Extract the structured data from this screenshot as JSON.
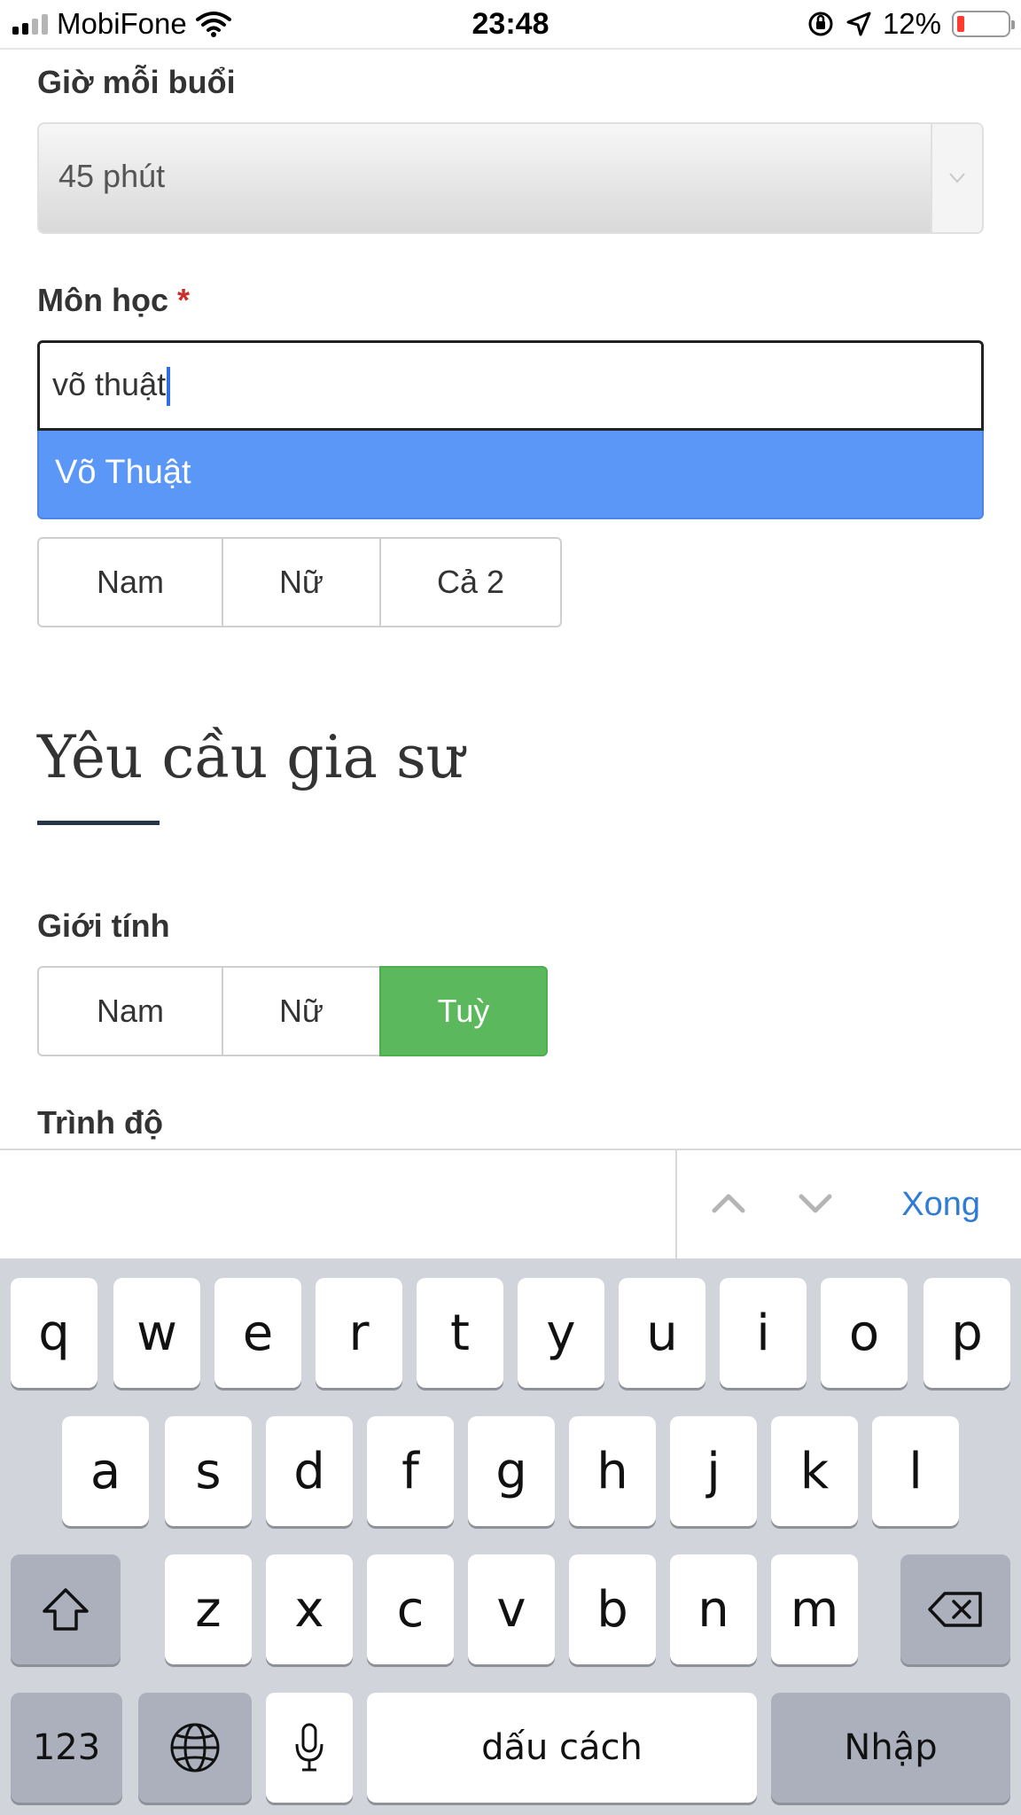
{
  "status_bar": {
    "carrier": "MobiFone",
    "time": "23:48",
    "battery_percent": "12%"
  },
  "form": {
    "hours_label": "Giờ mỗi buổi",
    "hours_value": "45 phút",
    "subject_label": "Môn học",
    "required_mark": "*",
    "subject_input_value": "võ thuật",
    "subject_suggestion": "Võ Thuật",
    "student_gender_options": [
      "Nam",
      "Nữ",
      "Cả 2"
    ],
    "section_title": "Yêu cầu gia sư",
    "tutor_gender_label": "Giới tính",
    "tutor_gender_options": [
      "Nam",
      "Nữ",
      "Tuỳ"
    ],
    "tutor_gender_selected": "Tuỳ",
    "level_label": "Trình độ"
  },
  "accessory_bar": {
    "done_label": "Xong"
  },
  "keyboard": {
    "row1": [
      "q",
      "w",
      "e",
      "r",
      "t",
      "y",
      "u",
      "i",
      "o",
      "p"
    ],
    "row2": [
      "a",
      "s",
      "d",
      "f",
      "g",
      "h",
      "j",
      "k",
      "l"
    ],
    "row3": [
      "z",
      "x",
      "c",
      "v",
      "b",
      "n",
      "m"
    ],
    "numbers_key": "123",
    "space_key": "dấu cách",
    "return_key": "Nhập"
  },
  "colors": {
    "selected_green": "#5cb85c",
    "suggestion_blue": "#5b97f7",
    "link_blue": "#2f7cd6",
    "required_red": "#c9302c"
  }
}
